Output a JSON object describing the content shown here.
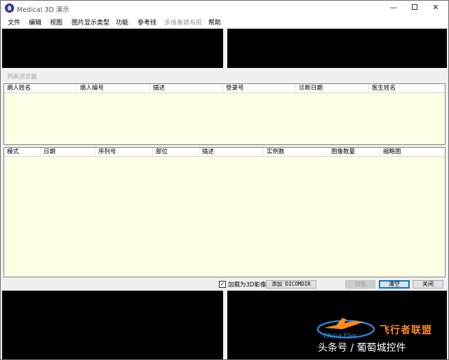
{
  "window": {
    "title": "Medical 3D 演示",
    "controls": {
      "minimize": "—",
      "close": "✕"
    }
  },
  "menubar": {
    "items": [
      {
        "label": "文件",
        "enabled": true
      },
      {
        "label": "编辑",
        "enabled": true
      },
      {
        "label": "视图",
        "enabled": true
      },
      {
        "label": "图片显示类型",
        "enabled": true
      },
      {
        "label": "功能",
        "enabled": true
      },
      {
        "label": "参考线",
        "enabled": true
      },
      {
        "label": "多维重建布局",
        "enabled": false
      },
      {
        "label": "帮助",
        "enabled": true
      }
    ]
  },
  "browser": {
    "title": "列表浏览器",
    "patients_table": {
      "columns": [
        "病人姓名",
        "病人编号",
        "描述",
        "登录号",
        "诊断日期",
        "医生姓名"
      ],
      "rows": []
    },
    "series_table": {
      "columns": [
        "模式",
        "日期",
        "序列号",
        "部位",
        "描述",
        "实例数",
        "图像数量",
        "缩略图"
      ],
      "rows": []
    },
    "load_3d_checkbox": {
      "label": "加载为3D影像",
      "checked": true,
      "mark": "✓"
    },
    "buttons": {
      "add_dicomdir": "添加 DICOMDIR",
      "load": "加载",
      "clear": "清空",
      "close": "关闭"
    }
  },
  "watermark": {
    "brand": "飞行者联盟",
    "sub": "China Flier",
    "caption": "头条号 / 葡萄城控件"
  },
  "colors": {
    "grid_background": "#ffffe6",
    "viewport_background": "#000000",
    "default_button_border": "#0078d7",
    "watermark_orange": "#ff8a1c"
  }
}
